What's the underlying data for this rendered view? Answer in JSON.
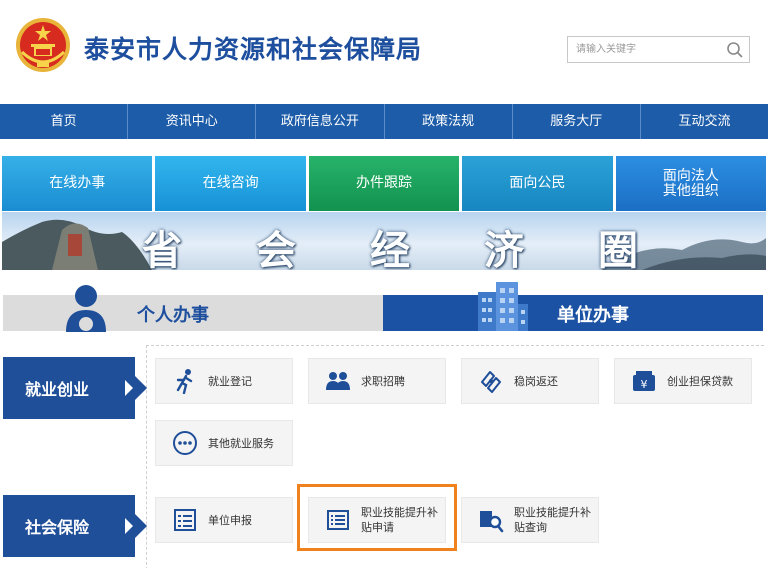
{
  "header": {
    "site_title": "泰安市人力资源和社会保障局",
    "search_placeholder": "请输入关键字"
  },
  "nav": {
    "items": [
      "首页",
      "资讯中心",
      "政府信息公开",
      "政策法规",
      "服务大厅",
      "互动交流"
    ]
  },
  "tiles": {
    "online_service": "在线办事",
    "online_consult": "在线咨询",
    "tracking": "办件跟踪",
    "for_public": "面向公民",
    "for_legal_line1": "面向法人",
    "for_legal_line2": "其他组织"
  },
  "banner": {
    "chars": [
      "省",
      "会",
      "经",
      "济",
      "圈"
    ]
  },
  "tabs": {
    "personal": "个人办事",
    "unit": "单位办事"
  },
  "categories": {
    "employment": "就业创业",
    "social_insurance": "社会保险"
  },
  "services": {
    "employment_registration": "就业登记",
    "job_recruitment": "求职招聘",
    "stable_job_refund": "稳岗返还",
    "startup_loan": "创业担保贷款",
    "other_employment": "其他就业服务",
    "unit_declaration": "单位申报",
    "skill_subsidy_apply_line1": "职业技能提升补",
    "skill_subsidy_apply_line2": "贴申请",
    "skill_subsidy_query_line1": "职业技能提升补",
    "skill_subsidy_query_line2": "贴查询"
  },
  "colors": {
    "brand_blue": "#1d5ca8",
    "title_blue": "#1d4f9e",
    "highlight_orange": "#f0821e",
    "tile_green": "#1fa35c"
  }
}
